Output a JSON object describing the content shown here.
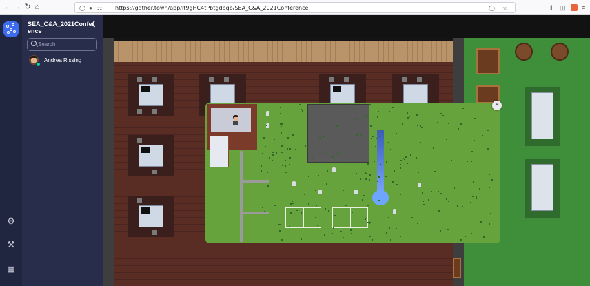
{
  "browser": {
    "url": "https://gather.town/app/it9gHC4tPbtgdbqb/SEA_C&A_2021Conference",
    "url_host": "gather.town",
    "icons": [
      "back-icon",
      "forward-icon",
      "reload-icon",
      "home-icon",
      "shield-icon",
      "lock-icon",
      "permissions-icon",
      "bookmark-star-icon",
      "pocket-icon",
      "library-icon",
      "sidebar-icon",
      "extension-icon",
      "menu-icon"
    ]
  },
  "rail": {
    "icons": [
      "gather-logo-icon",
      "settings-icon",
      "build-hammer-icon",
      "calendar-icon"
    ]
  },
  "panel": {
    "space_title": "SEA_C&A_2021Conference",
    "search": {
      "placeholder": "Search",
      "value": ""
    },
    "users": [
      {
        "name": "Andrea Rissing",
        "status": "online"
      }
    ]
  },
  "minimap": {
    "close_label": "×"
  },
  "colors": {
    "rail_bg": "#202540",
    "panel_bg": "#282d4c",
    "accent": "#3d6cf0",
    "online": "#06d6a0",
    "minimap_grass": "#67a33c"
  }
}
